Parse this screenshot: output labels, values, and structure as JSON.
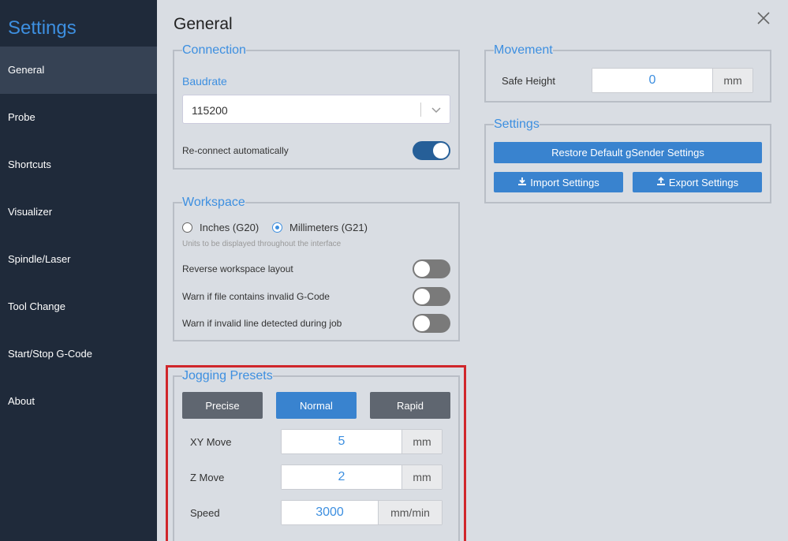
{
  "sidebar": {
    "title": "Settings",
    "items": [
      {
        "label": "General"
      },
      {
        "label": "Probe"
      },
      {
        "label": "Shortcuts"
      },
      {
        "label": "Visualizer"
      },
      {
        "label": "Spindle/Laser"
      },
      {
        "label": "Tool Change"
      },
      {
        "label": "Start/Stop G-Code"
      },
      {
        "label": "About"
      }
    ]
  },
  "main": {
    "title": "General",
    "close_icon": "close-icon"
  },
  "connection": {
    "legend": "Connection",
    "baudrate_label": "Baudrate",
    "baudrate_value": "115200",
    "reconnect_label": "Re-connect automatically",
    "reconnect_on": true
  },
  "workspace": {
    "legend": "Workspace",
    "inches_label": "Inches (G20)",
    "mm_label": "Millimeters (G21)",
    "units_hint": "Units to be displayed throughout the interface",
    "reverse_label": "Reverse workspace layout",
    "warn_file_label": "Warn if file contains invalid G-Code",
    "warn_line_label": "Warn if invalid line detected during job"
  },
  "jogging": {
    "legend": "Jogging Presets",
    "presets": [
      "Precise",
      "Normal",
      "Rapid"
    ],
    "active_preset": "Normal",
    "xy_label": "XY Move",
    "xy_value": "5",
    "xy_unit": "mm",
    "z_label": "Z Move",
    "z_value": "2",
    "z_unit": "mm",
    "speed_label": "Speed",
    "speed_value": "3000",
    "speed_unit": "mm/min"
  },
  "movement": {
    "legend": "Movement",
    "safe_height_label": "Safe Height",
    "safe_height_value": "0",
    "safe_height_unit": "mm"
  },
  "settings_panel": {
    "legend": "Settings",
    "restore_label": "Restore Default gSender Settings",
    "import_label": "Import Settings",
    "export_label": "Export Settings"
  },
  "colors": {
    "sidebar_bg": "#1f2a3a",
    "accent": "#3d8fe0",
    "highlight": "#d0262b"
  }
}
